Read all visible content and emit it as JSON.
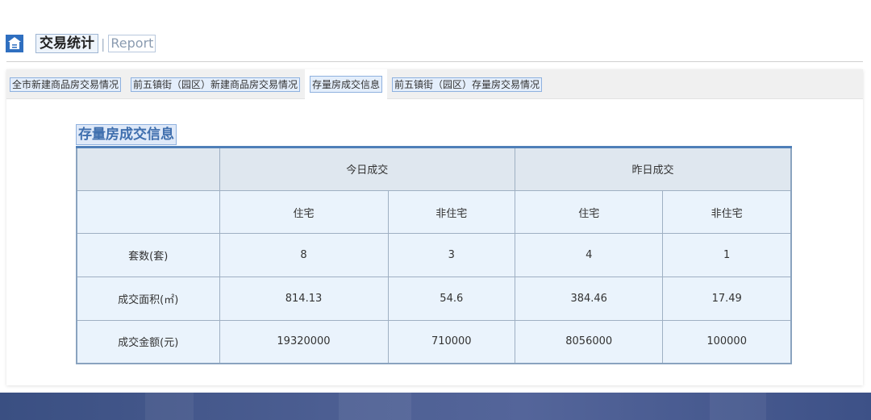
{
  "header": {
    "title": "交易统计",
    "separator": "|",
    "subtitle": "Report",
    "icon": "building-icon"
  },
  "tabs": [
    {
      "label": "全市新建商品房交易情况",
      "active": false
    },
    {
      "label": "前五镇街（园区）新建商品房交易情况",
      "active": false
    },
    {
      "label": "存量房成交信息",
      "active": true
    },
    {
      "label": "前五镇街（园区）存量房交易情况",
      "active": false
    }
  ],
  "table": {
    "title": "存量房成交信息",
    "group_headers": {
      "today": "今日成交",
      "yesterday": "昨日成交"
    },
    "sub_headers": {
      "today_residential": "住宅",
      "today_non_residential": "非住宅",
      "yesterday_residential": "住宅",
      "yesterday_non_residential": "非住宅"
    },
    "rows": [
      {
        "label": "套数(套)",
        "values": [
          "8",
          "3",
          "4",
          "1"
        ]
      },
      {
        "label": "成交面积(㎡)",
        "values": [
          "814.13",
          "54.6",
          "384.46",
          "17.49"
        ]
      },
      {
        "label": "成交金额(元)",
        "values": [
          "19320000",
          "710000",
          "8056000",
          "100000"
        ]
      }
    ]
  },
  "colors": {
    "accent": "#4f7fb8",
    "cell_bg": "#eaf3fc",
    "header_bg": "#dfe7ef",
    "footer_band": "#4a5c90"
  }
}
